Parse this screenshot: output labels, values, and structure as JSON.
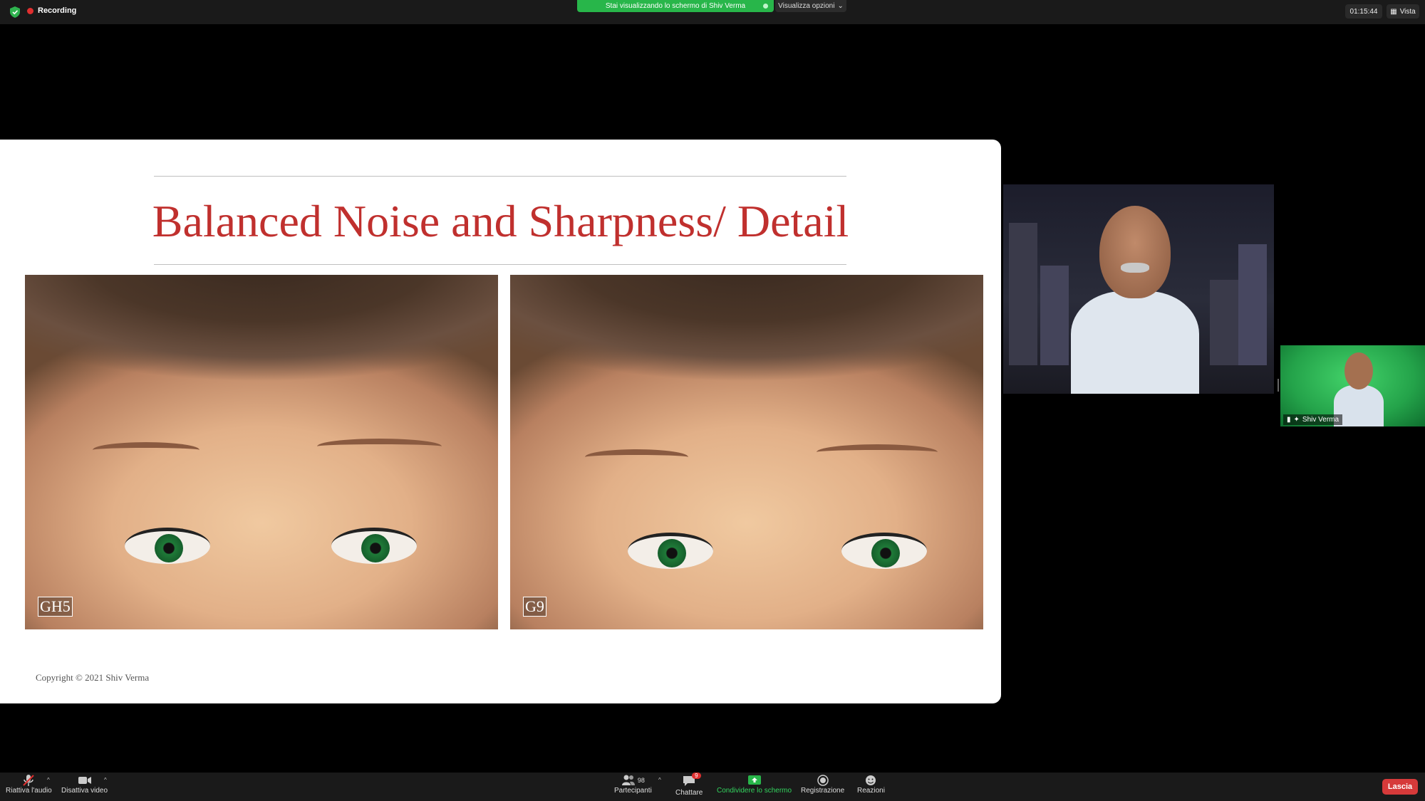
{
  "topbar": {
    "recording_label": "Recording",
    "share_banner_text": "Stai visualizzando lo schermo di Shiv Verma",
    "view_options_label": "Visualizza opzioni",
    "clock": "01:15:44",
    "view_label": "Vista"
  },
  "slide": {
    "title": "Balanced Noise and Sharpness/ Detail",
    "left_photo_tag": "GH5",
    "right_photo_tag": "G9",
    "copyright": "Copyright © 2021 Shiv Verma"
  },
  "participants": {
    "side_tile_name": "Shiv Verma"
  },
  "toolbar": {
    "unmute_label": "Riattiva l'audio",
    "stop_video_label": "Disattiva video",
    "participants_label": "Partecipanti",
    "participants_count": "98",
    "chat_label": "Chattare",
    "chat_badge": "9",
    "share_screen_label": "Condividere lo schermo",
    "record_label": "Registrazione",
    "reactions_label": "Reazioni",
    "leave_label": "Lascia"
  },
  "colors": {
    "accent_green": "#28b64a",
    "title_red": "#c0302e",
    "leave_red": "#d63a3a"
  }
}
